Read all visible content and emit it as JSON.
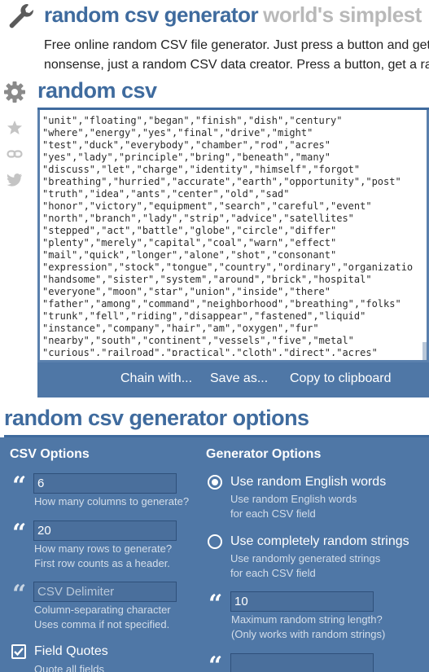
{
  "header": {
    "title": "random csv generator",
    "tagline": "world's simplest"
  },
  "intro": {
    "line1": "Free online random CSV file generator. Just press a button and get",
    "line2": "nonsense, just a random CSV data creator. Press a button, get a ra"
  },
  "tool": {
    "title": "random csv",
    "output_lines": [
      "\"unit\",\"floating\",\"began\",\"finish\",\"dish\",\"century\"",
      "\"where\",\"energy\",\"yes\",\"final\",\"drive\",\"might\"",
      "\"test\",\"duck\",\"everybody\",\"chamber\",\"rod\",\"acres\"",
      "\"yes\",\"lady\",\"principle\",\"bring\",\"beneath\",\"many\"",
      "\"discuss\",\"let\",\"charge\",\"identity\",\"himself\",\"forgot\"",
      "\"breathing\",\"hurried\",\"accurate\",\"earth\",\"opportunity\",\"post\"",
      "\"truth\",\"idea\",\"ants\",\"center\",\"old\",\"sad\"",
      "\"honor\",\"victory\",\"equipment\",\"search\",\"careful\",\"event\"",
      "\"north\",\"branch\",\"lady\",\"strip\",\"advice\",\"satellites\"",
      "\"stepped\",\"act\",\"battle\",\"globe\",\"circle\",\"differ\"",
      "\"plenty\",\"merely\",\"capital\",\"coal\",\"warn\",\"effect\"",
      "\"mail\",\"quick\",\"longer\",\"alone\",\"shot\",\"consonant\"",
      "\"expression\",\"stock\",\"tongue\",\"country\",\"ordinary\",\"organizatio",
      "\"handsome\",\"sister\",\"system\",\"around\",\"brick\",\"hospital\"",
      "\"everyone\",\"moon\",\"star\",\"union\",\"inside\",\"there\"",
      "\"father\",\"among\",\"command\",\"neighborhood\",\"breathing\",\"folks\"",
      "\"trunk\",\"fell\",\"riding\",\"disappear\",\"fastened\",\"liquid\"",
      "\"instance\",\"company\",\"hair\",\"am\",\"oxygen\",\"fur\"",
      "\"nearby\",\"south\",\"continent\",\"vessels\",\"five\",\"metal\"",
      "\"curious\",\"railroad\",\"practical\",\"cloth\",\"direct\",\"acres\""
    ],
    "actions": {
      "chain": "Chain with...",
      "save": "Save as...",
      "copy": "Copy to clipboard"
    }
  },
  "options": {
    "title": "random csv generator options",
    "csv": {
      "heading": "CSV Options",
      "columns": {
        "value": "6",
        "hint": "How many columns to generate?"
      },
      "rows": {
        "value": "20",
        "hint1": "How many rows to generate?",
        "hint2": "First row counts as a header."
      },
      "delimiter": {
        "placeholder": "CSV Delimiter",
        "hint1": "Column-separating character",
        "hint2": "Uses comma if not specified."
      },
      "quotes": {
        "label": "Field Quotes",
        "checked": true,
        "hint": "Quote all fields"
      }
    },
    "generator": {
      "heading": "Generator Options",
      "english": {
        "label": "Use random English words",
        "hint1": "Use random English words",
        "hint2": "for each CSV field",
        "checked": true
      },
      "random": {
        "label": "Use completely random strings",
        "hint1": "Use randomly generated strings",
        "hint2": "for each CSV field",
        "checked": false
      },
      "maxlen": {
        "value": "10",
        "hint1": "Maximum random string length?",
        "hint2": "(Only works with random strings)"
      }
    }
  },
  "colors": {
    "brand": "#3f6b9e",
    "panel": "#4f77a6",
    "tagline": "#b9b9b9"
  },
  "icons": [
    "wrench-icon",
    "gear-icon",
    "star-icon",
    "link-icon",
    "twitter-icon",
    "quote-icon",
    "checkbox-icon",
    "radio-icon"
  ]
}
